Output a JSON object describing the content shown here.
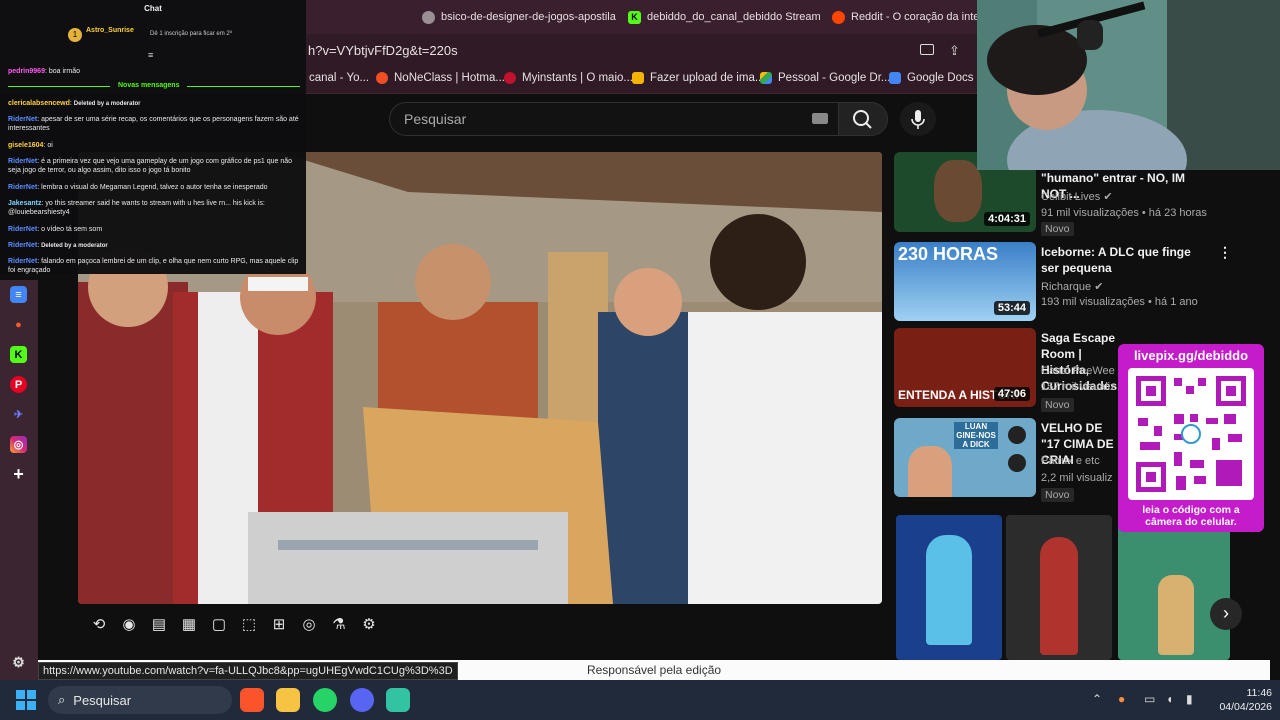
{
  "browser": {
    "tabs": [
      {
        "label": "bsico-de-designer-de-jogos-apostila",
        "icon": "globe-icon",
        "color": "#9a8f94"
      },
      {
        "label": "debiddo_do_canal_debiddo Stream",
        "icon": "kick-icon",
        "color": "#53fc18"
      },
      {
        "label": "Reddit - O coração da intern",
        "icon": "reddit-icon",
        "color": "#ff4500"
      }
    ],
    "url": "h?v=VYbtjvFfD2g&t=220s",
    "bookmarks": [
      {
        "label": "canal - Yo...",
        "icon": "youtube-icon",
        "color": "#ff0000"
      },
      {
        "label": "NoNeClass | Hotma...",
        "icon": "hotmart-icon",
        "color": "#f04e23"
      },
      {
        "label": "Myinstants | O maio...",
        "icon": "myinstants-icon",
        "color": "#c0122c"
      },
      {
        "label": "Fazer upload de ima...",
        "icon": "upload-icon",
        "color": "#f5b400"
      },
      {
        "label": "Pessoal - Google Dr...",
        "icon": "drive-icon",
        "color": "#34a853"
      },
      {
        "label": "Google Docs",
        "icon": "docs-icon",
        "color": "#4285f4"
      }
    ],
    "status_url": "https://www.youtube.com/watch?v=fa-ULLQJbc8&pp=ugUHEgVwdC1CUg%3D%3D"
  },
  "youtube": {
    "search_placeholder": "Pesquisar",
    "editing_bar": "Responsável pela edição",
    "recommendations": [
      {
        "title": "\"humano\" entrar - NO, IM NOT ...",
        "channel": "Cellbit Lives",
        "meta": "91 mil visualizações • há 23 horas",
        "badge": "Novo",
        "duration": "4:04:31"
      },
      {
        "title": "Iceborne: A DLC que finge ser pequena",
        "channel": "Richarque",
        "meta": "193 mil visualizações • há 1 ano",
        "badge": "",
        "duration": "53:44",
        "thumb_text": "230 HORAS"
      },
      {
        "title": "Saga Escape Room | História, Curiosidades e",
        "channel": "Canal PeeWee",
        "meta": "157 mil visualiz",
        "badge": "Novo",
        "duration": "47:06",
        "thumb_text": "ENTENDA A HISTÓRI"
      },
      {
        "title": "VELHO DE \"17 CIMA DE CRIAI",
        "channel": "Patrux e etc",
        "meta": "2,2 mil visualiz",
        "badge": "Novo",
        "duration": "",
        "thumb_text": "LUAN GINE-NOS A DICK"
      }
    ]
  },
  "chat": {
    "title": "Chat",
    "sub_user": "Astro_Sunrise",
    "sub_note": "Dê 1 inscrição para ficar em 2º",
    "new_messages": "Novas mensagens",
    "messages": [
      {
        "user": "pedrin9969",
        "text": "boa irmão",
        "color": "#ff5cf0"
      },
      {
        "user": "clericalabsencewd",
        "text": "Deleted by a moderator",
        "color": "#ffd23f"
      },
      {
        "user": "RiderNet",
        "text": "apesar de ser uma série recap, os comentários que os personagens fazem são até interessantes",
        "color": "#5b8cff"
      },
      {
        "user": "gisele1604",
        "text": "oi",
        "color": "#ffd23f"
      },
      {
        "user": "RiderNet",
        "text": "é a primeira vez que vejo uma gameplay de um jogo com gráfico de ps1 que não seja jogo de terror, ou algo assim, dito isso o jogo tá bonito",
        "color": "#5b8cff"
      },
      {
        "user": "RiderNet",
        "text": "lembra o visual do Megaman Legend, talvez o autor tenha se inesperado",
        "color": "#5b8cff"
      },
      {
        "user": "Jakesantz",
        "text": "yo this streamer said he wants to stream with u hes live rn... his kick is: @louiebearshiesty4",
        "color": "#7fd3ff"
      },
      {
        "user": "RiderNet",
        "text": "o vídeo tá sem som",
        "color": "#5b8cff"
      },
      {
        "user": "RiderNet",
        "text": "Deleted by a moderator",
        "color": "#5b8cff"
      },
      {
        "user": "RiderNet",
        "text": "falando em paçoca lembrei de um clip, e olha que nem curto RPG, mas aquele clip foi engraçado",
        "color": "#5b8cff"
      }
    ]
  },
  "livepix": {
    "title": "livepix.gg/debiddo",
    "caption": "leia o código com a câmera do celular."
  },
  "taskbar": {
    "search_label": "Pesquisar",
    "time": "11:46",
    "date": "04/04/2026",
    "apps": [
      "brave-icon",
      "files-icon",
      "whatsapp-icon",
      "discord-icon",
      "streamlabs-icon"
    ]
  }
}
